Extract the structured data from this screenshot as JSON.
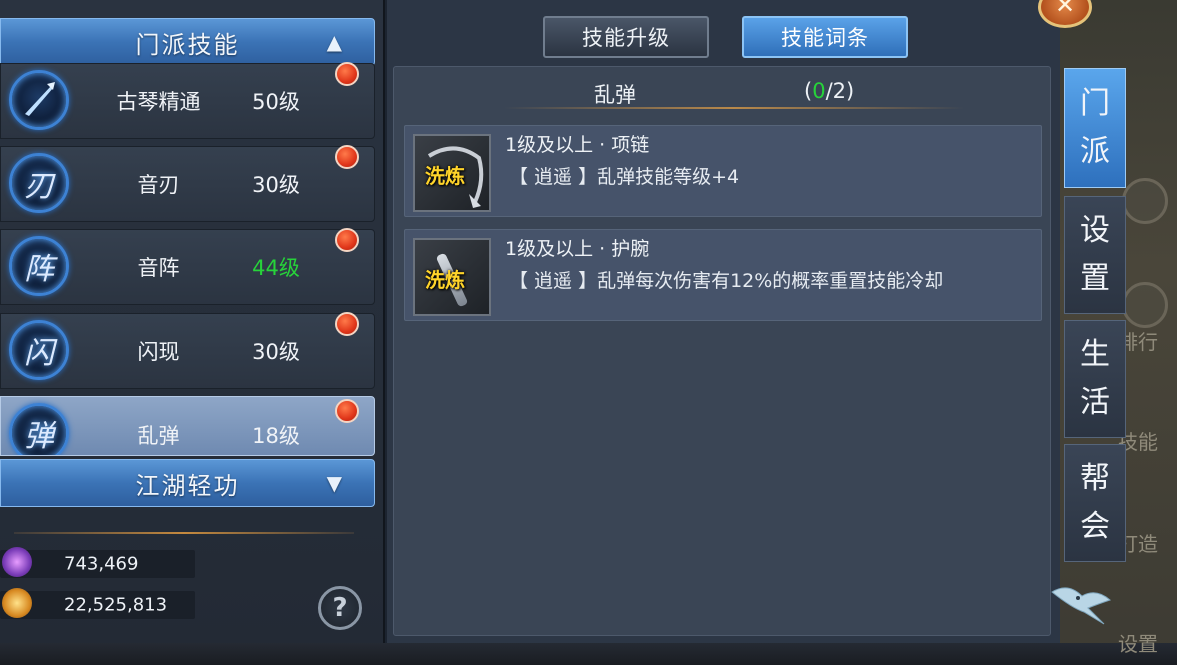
{
  "left_panel": {
    "section1_title": "门派技能",
    "section2_title": "江湖轻功",
    "skills": [
      {
        "name": "古琴精通",
        "level": "50级",
        "glyph": "",
        "level_color": "white"
      },
      {
        "name": "音刃",
        "level": "30级",
        "glyph": "刃",
        "level_color": "white"
      },
      {
        "name": "音阵",
        "level": "44级",
        "glyph": "阵",
        "level_color": "green"
      },
      {
        "name": "闪现",
        "level": "30级",
        "glyph": "闪",
        "level_color": "white"
      },
      {
        "name": "乱弹",
        "level": "18级",
        "glyph": "弹",
        "level_color": "white",
        "selected": true
      }
    ],
    "currency": [
      {
        "icon": "crystal-icon",
        "value": "743,469"
      },
      {
        "icon": "gold-ingot-icon",
        "value": "22,525,813"
      }
    ],
    "help_symbol": "?"
  },
  "tabs": {
    "upgrade": "技能升级",
    "affix": "技能词条"
  },
  "entries": {
    "title": "乱弹",
    "count_open": "(",
    "count_current": "0",
    "count_rest": "/2)",
    "items": [
      {
        "req": "1级及以上 · 项链",
        "tag": "洗炼",
        "effect": "【 逍遥 】乱弹技能等级+4"
      },
      {
        "req": "1级及以上 · 护腕",
        "tag": "洗炼",
        "effect": "【 逍遥 】乱弹每次伤害有12%的概率重置技能冷却"
      }
    ]
  },
  "side_tabs": [
    {
      "chars": [
        "门",
        "派"
      ],
      "active": true
    },
    {
      "chars": [
        "设",
        "置"
      ],
      "active": false
    },
    {
      "chars": [
        "生",
        "活"
      ],
      "active": false
    },
    {
      "chars": [
        "帮",
        "会"
      ],
      "active": false
    }
  ],
  "background_labels": {
    "rank": "排行",
    "skill": "技能",
    "forge": "打造",
    "settings": "设置"
  },
  "colors": {
    "accent_blue": "#3b73b6",
    "level_green": "#27d33a",
    "notify_red": "#e0361a",
    "tag_yellow": "#ffd42a"
  }
}
